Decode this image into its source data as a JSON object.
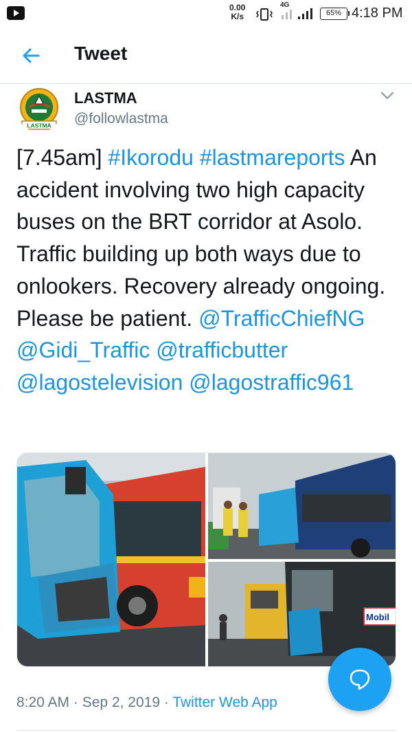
{
  "status_bar": {
    "speed_value": "0.00",
    "speed_unit": "K/s",
    "network": "4G",
    "battery": "65%",
    "time": "4:18 PM"
  },
  "header": {
    "title": "Tweet"
  },
  "tweet": {
    "author_name": "LASTMA",
    "author_handle": "@followlastma",
    "avatar_text": "LASTMA",
    "segments": [
      {
        "text": "[7.45am] ",
        "link": false
      },
      {
        "text": "#Ikorodu",
        "link": true
      },
      {
        "text": " ",
        "link": false
      },
      {
        "text": "#lastmareports",
        "link": true
      },
      {
        "text": " An accident involving two high capacity buses on the BRT corridor at Asolo. Traffic building up both ways due to onlookers. Recovery already ongoing. Please be patient. ",
        "link": false
      },
      {
        "text": "@TrafficChiefNG",
        "link": true
      },
      {
        "text": " ",
        "link": false
      },
      {
        "text": "@Gidi_Traffic",
        "link": true
      },
      {
        "text": " ",
        "link": false
      },
      {
        "text": "@trafficbutter",
        "link": true
      },
      {
        "text": " ",
        "link": false
      },
      {
        "text": "@lagostelevision",
        "link": true
      },
      {
        "text": " ",
        "link": false
      },
      {
        "text": "@lagostraffic961",
        "link": true
      }
    ],
    "photo_sign_text": "Mobil",
    "time": "8:20 AM",
    "separator": "·",
    "date": "Sep 2, 2019",
    "source": "Twitter Web App"
  },
  "colors": {
    "link": "#1b95e0",
    "fab": "#1da1f2",
    "muted": "#657786"
  }
}
